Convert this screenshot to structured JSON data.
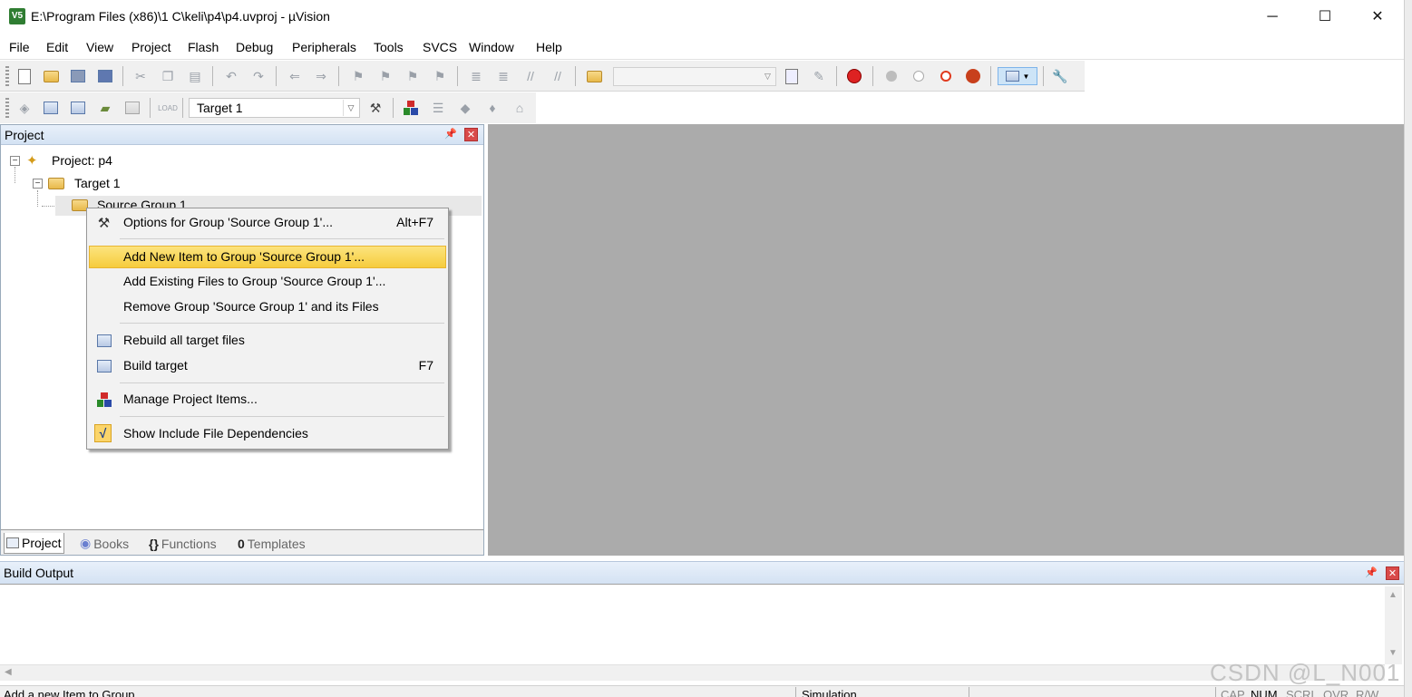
{
  "window": {
    "title": "E:\\Program Files (x86)\\1 C\\keli\\p4\\p4.uvproj - µVision",
    "icon_text": "V5",
    "minimize_glyph": "─",
    "maximize_glyph": "☐",
    "close_glyph": "✕"
  },
  "menubar": [
    "File",
    "Edit",
    "View",
    "Project",
    "Flash",
    "Debug",
    "Peripherals",
    "Tools",
    "SVCS",
    "Window",
    "Help"
  ],
  "toolbar": {
    "target_value": "Target 1",
    "combo_value": ""
  },
  "project_panel": {
    "title": "Project",
    "tree": {
      "root_label": "Project: p4",
      "target_label": "Target 1",
      "group_label": "Source Group 1"
    },
    "tabs": [
      {
        "label": "Project",
        "active": true
      },
      {
        "label": "Books",
        "active": false
      },
      {
        "label": "Functions",
        "active": false
      },
      {
        "label": "Templates",
        "active": false
      }
    ],
    "tab_icon_glyphs": {
      "books": "◉",
      "functions": "{}",
      "templates": "0"
    }
  },
  "context_menu": {
    "items": [
      {
        "label": "Options for Group 'Source Group 1'...",
        "shortcut": "Alt+F7",
        "icon": "magic-wand-icon"
      },
      {
        "label": "Add New  Item to Group 'Source Group 1'...",
        "shortcut": "",
        "icon": "",
        "highlighted": true
      },
      {
        "label": "Add Existing Files to Group 'Source Group 1'...",
        "shortcut": "",
        "icon": ""
      },
      {
        "label": "Remove Group 'Source Group 1' and its Files",
        "shortcut": "",
        "icon": ""
      },
      {
        "label": "Rebuild all target files",
        "shortcut": "",
        "icon": "rebuild-icon"
      },
      {
        "label": "Build target",
        "shortcut": "F7",
        "icon": "build-icon"
      },
      {
        "label": "Manage Project Items...",
        "shortcut": "",
        "icon": "manage-items-icon"
      },
      {
        "label": "Show Include File Dependencies",
        "shortcut": "",
        "icon": "check-icon",
        "checked": true
      }
    ],
    "check_glyph": "√"
  },
  "build_output": {
    "title": "Build Output"
  },
  "statusbar": {
    "message": "Add a new Item to Group",
    "mode": "Simulation",
    "indicators": [
      "CAP",
      "NUM",
      "SCRL",
      "OVR",
      "R/W"
    ]
  },
  "watermark": "CSDN @L_N001",
  "colors": {
    "menu_highlight": "#f6cc3d",
    "editor_background": "#ababab",
    "panel_header": "#d4e2f3",
    "close_red": "#d94a4a"
  }
}
